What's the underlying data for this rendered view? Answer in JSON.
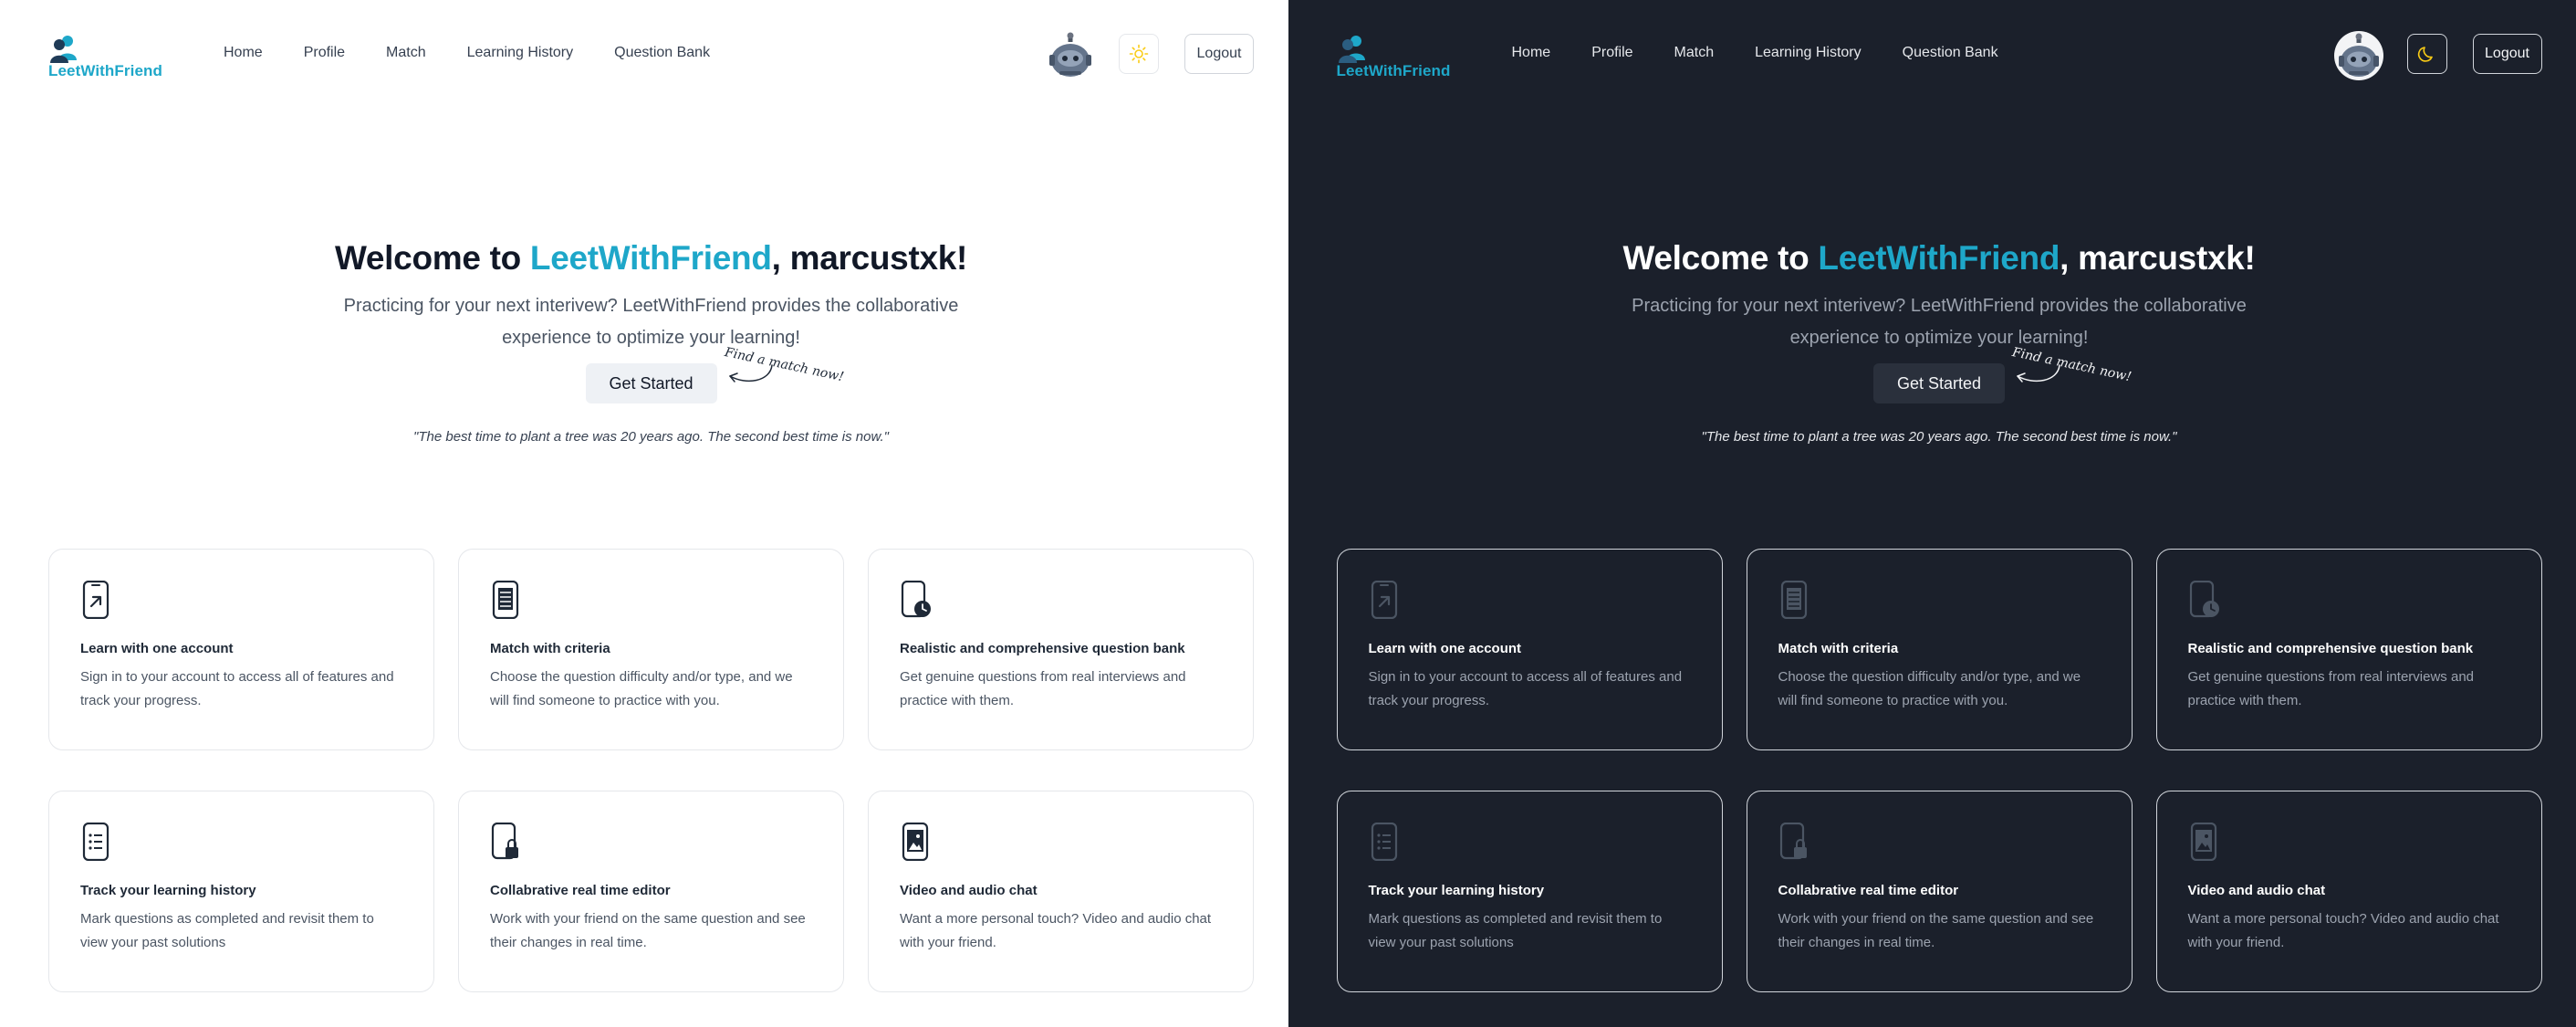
{
  "app": {
    "name": "LeetWithFriend",
    "brand_color": "#1ea7c9"
  },
  "nav": {
    "items": [
      "Home",
      "Profile",
      "Match",
      "Learning History",
      "Question Bank"
    ],
    "logout_label": "Logout"
  },
  "themes": {
    "light": {
      "background": "#ffffff",
      "toggle_icon": "sun-icon"
    },
    "dark": {
      "background": "#1b202b",
      "toggle_icon": "moon-icon"
    }
  },
  "hero": {
    "title_prefix": "Welcome to ",
    "title_brand": "LeetWithFriend",
    "title_suffix": ", marcustxk!",
    "description": "Practicing for your next interivew? LeetWithFriend provides the collaborative experience to optimize your learning!",
    "cta_label": "Get Started",
    "cta_note": "Find a match now!",
    "quote": "\"The best time to plant a tree was 20 years ago. The second best time is now.\""
  },
  "features": [
    {
      "icon": "phone-arrow-icon",
      "title": "Learn with one account",
      "description": "Sign in to your account to access all of features and track your progress."
    },
    {
      "icon": "phone-document-icon",
      "title": "Match with criteria",
      "description": "Choose the question difficulty and/or type, and we will find someone to practice with you."
    },
    {
      "icon": "phone-clock-icon",
      "title": "Realistic and comprehensive question bank",
      "description": "Get genuine questions from real interviews and practice with them."
    },
    {
      "icon": "phone-list-icon",
      "title": "Track your learning history",
      "description": "Mark questions as completed and revisit them to view your past solutions"
    },
    {
      "icon": "phone-lock-icon",
      "title": "Collabrative real time editor",
      "description": "Work with your friend on the same question and see their changes in real time."
    },
    {
      "icon": "phone-video-icon",
      "title": "Video and audio chat",
      "description": "Want a more personal touch? Video and audio chat with your friend."
    }
  ]
}
